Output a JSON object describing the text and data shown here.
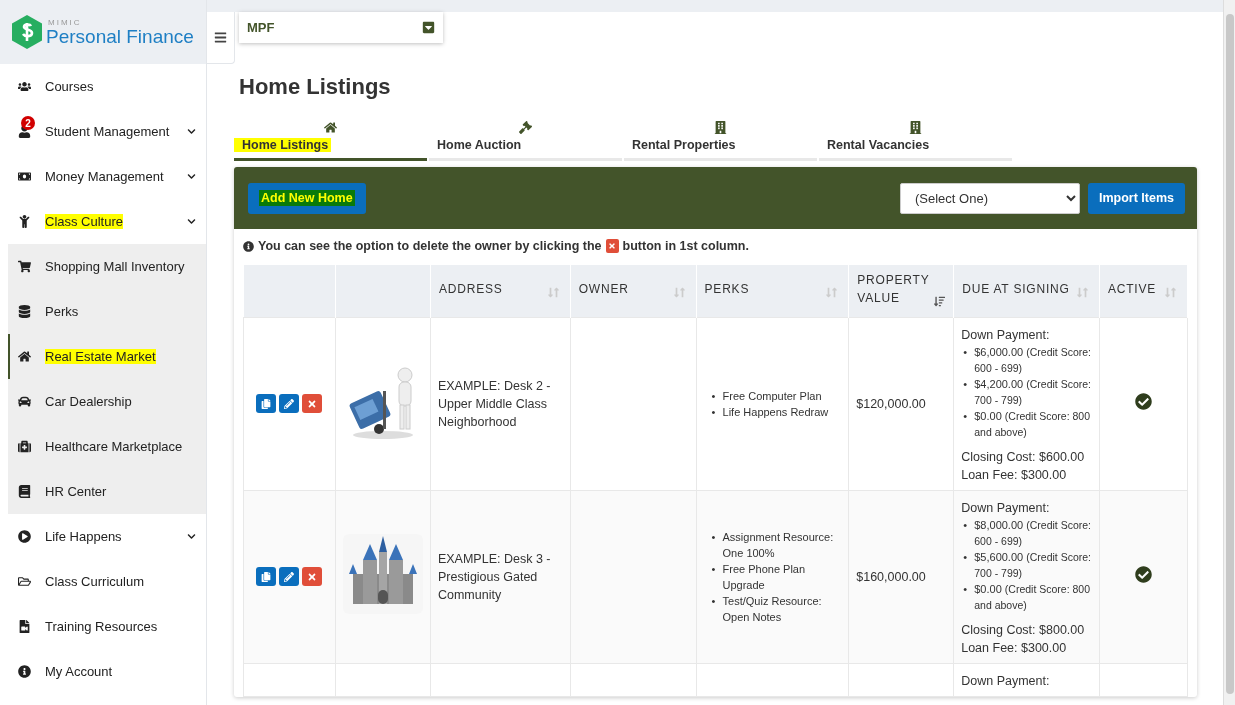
{
  "sidebar": {
    "logo": {
      "brand": "MIMIC",
      "name": "Personal Finance"
    },
    "items": [
      {
        "label": "Courses",
        "selected": false,
        "highlighted": false,
        "collapsible": false
      },
      {
        "label": "Student Management",
        "selected": false,
        "highlighted": false,
        "collapsible": true,
        "badge": "2"
      },
      {
        "label": "Money Management",
        "selected": false,
        "highlighted": false,
        "collapsible": true
      },
      {
        "label": "Class Culture",
        "selected": false,
        "highlighted": true,
        "collapsible": true,
        "children": [
          {
            "label": "Shopping Mall Inventory",
            "selected": false,
            "highlighted": false
          },
          {
            "label": "Perks",
            "selected": false,
            "highlighted": false
          },
          {
            "label": "Real Estate Market",
            "selected": true,
            "highlighted": true
          },
          {
            "label": "Car Dealership",
            "selected": false,
            "highlighted": false
          },
          {
            "label": "Healthcare Marketplace",
            "selected": false,
            "highlighted": false
          },
          {
            "label": "HR Center",
            "selected": false,
            "highlighted": false
          }
        ]
      },
      {
        "label": "Life Happens",
        "selected": false,
        "highlighted": false,
        "collapsible": true
      },
      {
        "label": "Class Curriculum",
        "selected": false,
        "highlighted": false,
        "collapsible": false
      },
      {
        "label": "Training Resources",
        "selected": false,
        "highlighted": false,
        "collapsible": false
      },
      {
        "label": "My Account",
        "selected": false,
        "highlighted": false,
        "collapsible": false
      }
    ]
  },
  "course_select": {
    "value": "MPF"
  },
  "page": {
    "title": "Home Listings"
  },
  "tabs": [
    {
      "label": "Home Listings",
      "selected": true,
      "highlighted": true
    },
    {
      "label": "Home Auction",
      "selected": false,
      "highlighted": false
    },
    {
      "label": "Rental Properties",
      "selected": false,
      "highlighted": false
    },
    {
      "label": "Rental Vacancies",
      "selected": false,
      "highlighted": false
    }
  ],
  "toolbar": {
    "add_button": {
      "label": "Add New Home",
      "highlighted": true
    },
    "select": {
      "value": "(Select One)"
    },
    "import_button": {
      "label": "Import Items"
    }
  },
  "note": {
    "before": "You can see the option to delete the owner by clicking the",
    "after": "button in 1st column."
  },
  "table": {
    "columns": [
      {
        "label": "ADDRESS",
        "sorted": false
      },
      {
        "label": "OWNER",
        "sorted": false
      },
      {
        "label": "PERKS",
        "sorted": false
      },
      {
        "label": "PROPERTY VALUE",
        "sorted": true
      },
      {
        "label": "DUE AT SIGNING",
        "sorted": false
      },
      {
        "label": "ACTIVE",
        "sorted": false
      }
    ],
    "rows": [
      {
        "kind": "full",
        "address": "EXAMPLE: Desk 2 - Upper Middle Class Neighborhood",
        "perks": [
          {
            "marker": "•",
            "text": "Free Computer Plan"
          },
          {
            "marker": "•",
            "text": "Life Happens Redraw"
          }
        ],
        "property_value": "$120,000.00",
        "due": {
          "heading": "Down Payment:",
          "tiers": [
            {
              "marker": "•",
              "amount": "$6,000.00",
              "note": "(Credit Score: 600 - 699)"
            },
            {
              "marker": "•",
              "amount": "$4,200.00",
              "note": "(Credit Score: 700 - 799)"
            },
            {
              "marker": "•",
              "amount": "$0.00",
              "note": "(Credit Score: 800 and above)"
            }
          ],
          "closing": "Closing Cost: $600.00",
          "loan": "Loan Fee: $300.00"
        },
        "active": true
      },
      {
        "kind": "full",
        "address": "EXAMPLE: Desk 3 - Prestigious Gated Community",
        "perks": [
          {
            "marker": "•",
            "text": "Assignment Resource: One 100%"
          },
          {
            "marker": "•",
            "text": "Free Phone Plan Upgrade"
          },
          {
            "marker": "•",
            "text": "Test/Quiz Resource: Open Notes"
          }
        ],
        "property_value": "$160,000.00",
        "due": {
          "heading": "Down Payment:",
          "tiers": [
            {
              "marker": "•",
              "amount": "$8,000.00",
              "note": "(Credit Score: 600 - 699)"
            },
            {
              "marker": "•",
              "amount": "$5,600.00",
              "note": "(Credit Score: 700 - 799)"
            },
            {
              "marker": "•",
              "amount": "$0.00",
              "note": "(Credit Score: 800 and above)"
            }
          ],
          "closing": "Closing Cost: $800.00",
          "loan": "Loan Fee: $300.00"
        },
        "active": true
      },
      {
        "kind": "partial",
        "due": {
          "heading": "Down Payment:"
        }
      }
    ]
  }
}
